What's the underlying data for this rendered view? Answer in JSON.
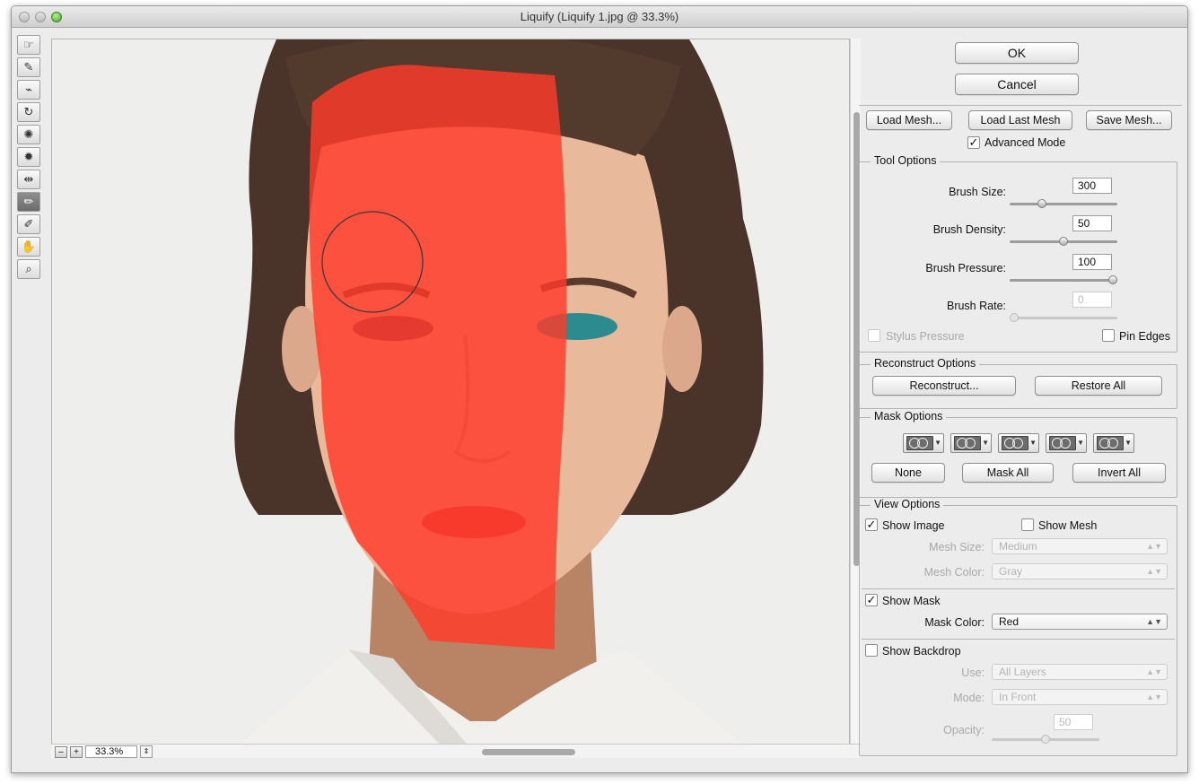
{
  "window": {
    "title": "Liquify (Liquify 1.jpg @ 33.3%)"
  },
  "toolbar": {
    "tools": [
      {
        "icon": "forward-warp-icon",
        "glyph": "☞"
      },
      {
        "icon": "reconstruct-icon",
        "glyph": "✎"
      },
      {
        "icon": "smooth-icon",
        "glyph": "⌁"
      },
      {
        "icon": "twirl-icon",
        "glyph": "↻"
      },
      {
        "icon": "pucker-icon",
        "glyph": "✺"
      },
      {
        "icon": "bloat-icon",
        "glyph": "✹"
      },
      {
        "icon": "push-left-icon",
        "glyph": "⇹"
      },
      {
        "icon": "freeze-mask-icon",
        "glyph": "✏"
      },
      {
        "icon": "thaw-mask-icon",
        "glyph": "✐"
      },
      {
        "icon": "hand-icon",
        "glyph": "✋"
      },
      {
        "icon": "zoom-icon",
        "glyph": "⌕"
      }
    ]
  },
  "zoom": {
    "minus": "–",
    "plus": "+",
    "value": "33.3%"
  },
  "buttons": {
    "ok": "OK",
    "cancel": "Cancel",
    "load_mesh": "Load Mesh...",
    "load_last_mesh": "Load Last Mesh",
    "save_mesh": "Save Mesh..."
  },
  "advanced_mode": {
    "label": "Advanced Mode",
    "checked": true
  },
  "tool_options": {
    "legend": "Tool Options",
    "brush_size": {
      "label": "Brush Size:",
      "value": "300",
      "level": 0.28
    },
    "brush_density": {
      "label": "Brush Density:",
      "value": "50",
      "level": 0.5
    },
    "brush_pressure": {
      "label": "Brush Pressure:",
      "value": "100",
      "level": 1.0
    },
    "brush_rate": {
      "label": "Brush Rate:",
      "value": "0",
      "level": 0.0
    },
    "stylus_pressure": "Stylus Pressure",
    "pin_edges": "Pin Edges"
  },
  "reconstruct_options": {
    "legend": "Reconstruct Options",
    "reconstruct": "Reconstruct...",
    "restore_all": "Restore All"
  },
  "mask_options": {
    "legend": "Mask Options",
    "none": "None",
    "mask_all": "Mask All",
    "invert_all": "Invert All"
  },
  "view_options": {
    "legend": "View Options",
    "show_image": "Show Image",
    "show_mesh": "Show Mesh",
    "mesh_size_label": "Mesh Size:",
    "mesh_size_value": "Medium",
    "mesh_color_label": "Mesh Color:",
    "mesh_color_value": "Gray",
    "show_mask": "Show Mask",
    "mask_color_label": "Mask Color:",
    "mask_color_value": "Red",
    "show_backdrop": "Show Backdrop",
    "use_label": "Use:",
    "use_value": "All Layers",
    "mode_label": "Mode:",
    "mode_value": "In Front",
    "opacity_label": "Opacity:",
    "opacity_value": "50",
    "opacity_level": 0.5
  },
  "colors": {
    "mask_overlay": "#ff3b2a",
    "background": "#eeeeec"
  }
}
